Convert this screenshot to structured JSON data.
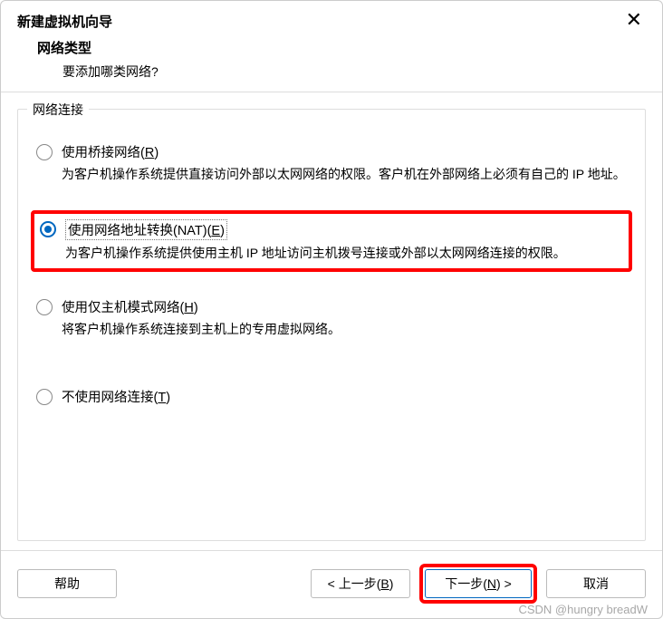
{
  "dialog": {
    "title": "新建虚拟机向导",
    "header_title": "网络类型",
    "header_subtitle": "要添加哪类网络?"
  },
  "group": {
    "legend": "网络连接"
  },
  "options": {
    "bridged": {
      "label_pre": "使用桥接网络(",
      "hotkey": "R",
      "label_post": ")",
      "desc": "为客户机操作系统提供直接访问外部以太网网络的权限。客户机在外部网络上必须有自己的 IP 地址。"
    },
    "nat": {
      "label_pre": "使用网络地址转换(NAT)(",
      "hotkey": "E",
      "label_post": ")",
      "desc": "为客户机操作系统提供使用主机 IP 地址访问主机拨号连接或外部以太网网络连接的权限。"
    },
    "hostonly": {
      "label_pre": "使用仅主机模式网络(",
      "hotkey": "H",
      "label_post": ")",
      "desc": "将客户机操作系统连接到主机上的专用虚拟网络。"
    },
    "none": {
      "label_pre": "不使用网络连接(",
      "hotkey": "T",
      "label_post": ")"
    }
  },
  "buttons": {
    "help": "帮助",
    "back_pre": "< 上一步(",
    "back_hot": "B",
    "back_post": ")",
    "next_pre": "下一步(",
    "next_hot": "N",
    "next_post": ") >",
    "cancel": "取消"
  },
  "watermark": "CSDN @hungry breadW"
}
